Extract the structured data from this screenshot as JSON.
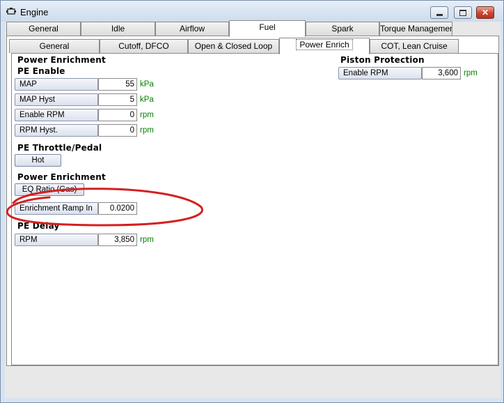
{
  "window": {
    "title": "Engine"
  },
  "main_tabs": [
    {
      "label": "General",
      "active": false
    },
    {
      "label": "Idle",
      "active": false
    },
    {
      "label": "Airflow",
      "active": false
    },
    {
      "label": "Fuel",
      "active": true
    },
    {
      "label": "Spark",
      "active": false
    },
    {
      "label": "Torque Management",
      "active": false
    }
  ],
  "sub_tabs": [
    {
      "label": "General",
      "active": false
    },
    {
      "label": "Cutoff, DFCO",
      "active": false
    },
    {
      "label": "Open & Closed Loop",
      "active": false
    },
    {
      "label": "Power Enrich",
      "active": true
    },
    {
      "label": "COT, Lean Cruise",
      "active": false
    }
  ],
  "left": {
    "section_title": "Power Enrichment",
    "pe_enable": {
      "title": "PE Enable",
      "rows": [
        {
          "label": "MAP",
          "value": "55",
          "unit": "kPa"
        },
        {
          "label": "MAP Hyst",
          "value": "5",
          "unit": "kPa"
        },
        {
          "label": "Enable RPM",
          "value": "0",
          "unit": "rpm"
        },
        {
          "label": "RPM Hyst.",
          "value": "0",
          "unit": "rpm"
        }
      ]
    },
    "throttle": {
      "title": "PE Throttle/Pedal",
      "button": "Hot"
    },
    "enrichment": {
      "title": "Power Enrichment",
      "button": "EQ Ratio (Gas)",
      "ramp": {
        "label": "Enrichment Ramp In",
        "value": "0.0200"
      }
    },
    "delay": {
      "title": "PE Delay",
      "row": {
        "label": "RPM",
        "value": "3,850",
        "unit": "rpm"
      }
    }
  },
  "right": {
    "title": "Piston Protection",
    "row": {
      "label": "Enable RPM",
      "value": "3,600",
      "unit": "rpm"
    }
  },
  "colors": {
    "highlight_ellipse": "#d42020",
    "unit_text": "#008000"
  }
}
